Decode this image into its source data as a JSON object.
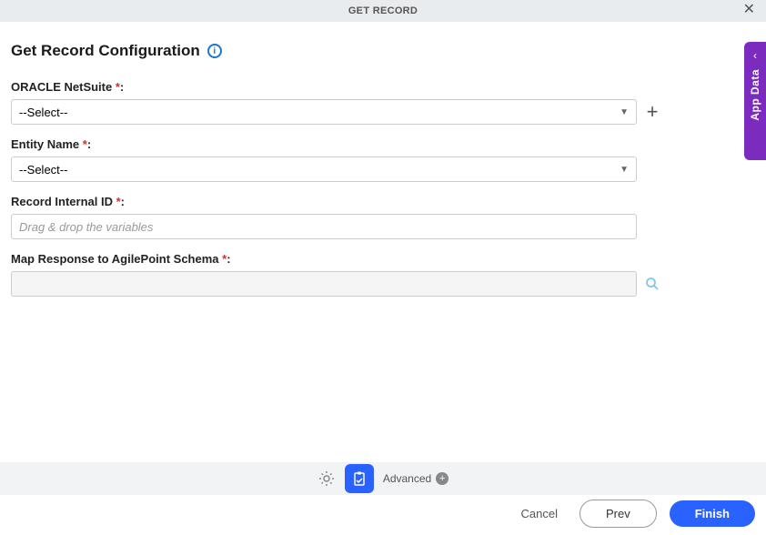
{
  "header": {
    "title": "GET RECORD"
  },
  "page": {
    "title": "Get Record Configuration"
  },
  "fields": {
    "netsuite": {
      "label": "ORACLE NetSuite",
      "value": "--Select--"
    },
    "entity": {
      "label": "Entity Name",
      "value": "--Select--"
    },
    "recordId": {
      "label": "Record Internal ID",
      "placeholder": "Drag & drop the variables"
    },
    "schema": {
      "label": "Map Response to AgilePoint Schema"
    }
  },
  "sidebar": {
    "appData": "App Data"
  },
  "toolbar": {
    "advanced": "Advanced"
  },
  "footer": {
    "cancel": "Cancel",
    "prev": "Prev",
    "finish": "Finish"
  }
}
